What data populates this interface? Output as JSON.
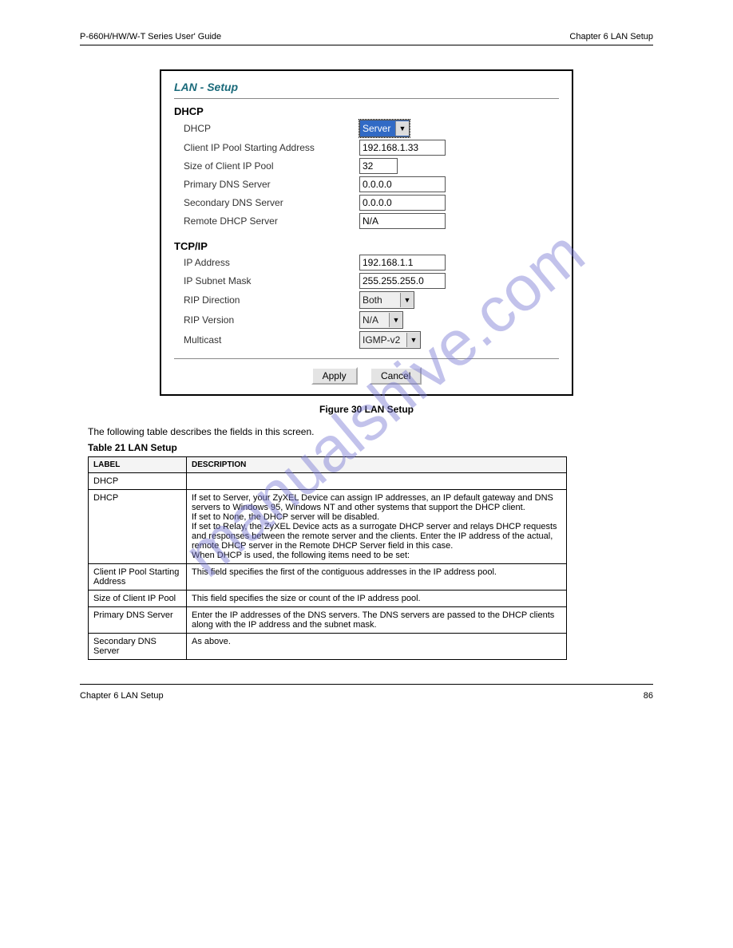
{
  "header": {
    "left": "P-660H/HW/W-T Series User' Guide",
    "right": "",
    "chapter_right": "Chapter 6 LAN Setup"
  },
  "watermark": "manualshive.com",
  "panel": {
    "title": "LAN - Setup",
    "dhcp_heading": "DHCP",
    "dhcp_label": "DHCP",
    "dhcp_value": "Server",
    "client_ip_start_label": "Client IP Pool Starting Address",
    "client_ip_start_value": "192.168.1.33",
    "pool_size_label": "Size of Client IP Pool",
    "pool_size_value": "32",
    "primary_dns_label": "Primary DNS Server",
    "primary_dns_value": "0.0.0.0",
    "secondary_dns_label": "Secondary DNS Server",
    "secondary_dns_value": "0.0.0.0",
    "remote_dhcp_label": "Remote DHCP Server",
    "remote_dhcp_value": "N/A",
    "tcpip_heading": "TCP/IP",
    "ip_addr_label": "IP Address",
    "ip_addr_value": "192.168.1.1",
    "subnet_label": "IP Subnet Mask",
    "subnet_value": "255.255.255.0",
    "rip_dir_label": "RIP Direction",
    "rip_dir_value": "Both",
    "rip_ver_label": "RIP Version",
    "rip_ver_value": "N/A",
    "multicast_label": "Multicast",
    "multicast_value": "IGMP-v2",
    "apply_label": "Apply",
    "cancel_label": "Cancel"
  },
  "figure_caption": "Figure 30   LAN Setup",
  "table_intro": "The following table describes the fields in this screen.",
  "table_caption": "Table 21   LAN Setup",
  "table": {
    "col1": "LABEL",
    "col2": "DESCRIPTION",
    "rows": [
      {
        "label": "DHCP",
        "desc": ""
      },
      {
        "label": "DHCP",
        "desc": "If set to Server, your ZyXEL Device can assign IP addresses, an IP default gateway and DNS servers to Windows 95, Windows NT and other systems that support the DHCP client.\nIf set to None, the DHCP server will be disabled.\nIf set to Relay, the ZyXEL Device acts as a surrogate DHCP server and relays DHCP requests and responses between the remote server and the clients. Enter the IP address of the actual, remote DHCP server in the Remote DHCP Server field in this case.\nWhen DHCP is used, the following items need to be set:"
      },
      {
        "label": "Client IP Pool Starting Address",
        "desc": "This field specifies the first of the contiguous addresses in the IP address pool."
      },
      {
        "label": "Size of Client IP Pool",
        "desc": "This field specifies the size or count of the IP address pool."
      },
      {
        "label": "Primary DNS Server",
        "desc": "Enter the IP addresses of the DNS servers. The DNS servers are passed to the DHCP clients along with the IP address and the subnet mask."
      },
      {
        "label": "Secondary DNS Server",
        "desc": "As above."
      }
    ]
  },
  "footer": {
    "left": "Chapter 6 LAN Setup",
    "right": "86"
  }
}
